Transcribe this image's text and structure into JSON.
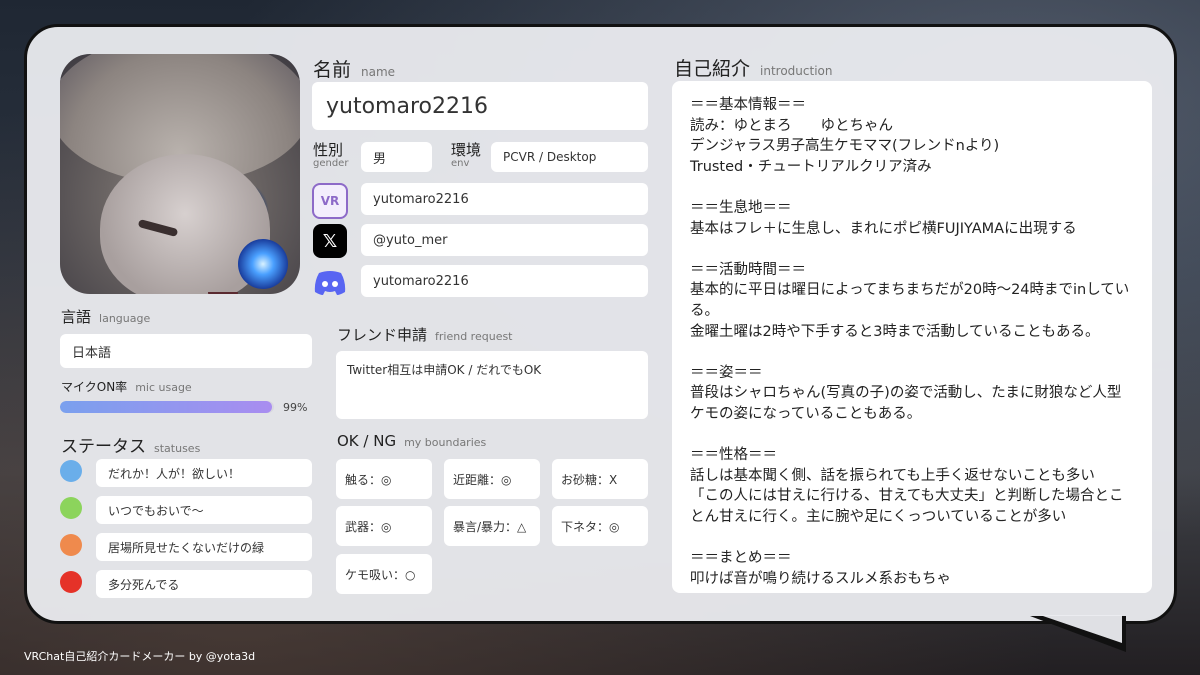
{
  "name": {
    "label_jp": "名前",
    "label_en": "name",
    "value": "yutomaro2216"
  },
  "gender": {
    "label_jp": "性別",
    "label_en": "gender",
    "value": "男"
  },
  "env": {
    "label_jp": "環境",
    "label_en": "env",
    "value": "PCVR / Desktop"
  },
  "sns": [
    {
      "icon": "vrchat-icon",
      "icon_text": "VR",
      "value": "yutomaro2216"
    },
    {
      "icon": "x-icon",
      "icon_text": "𝕏",
      "value": "@yuto_mer"
    },
    {
      "icon": "discord-icon",
      "icon_text": "",
      "value": "yutomaro2216"
    }
  ],
  "language": {
    "label_jp": "言語",
    "label_en": "language",
    "value": "日本語"
  },
  "mic": {
    "label_jp": "マイクON率",
    "label_en": "mic usage",
    "value": "99%",
    "percent": 99
  },
  "statuses": {
    "label_jp": "ステータス",
    "label_en": "statuses",
    "items": [
      {
        "color": "#6aaeea",
        "text": "だれか！人が！欲しい！"
      },
      {
        "color": "#8cd45c",
        "text": "いつでもおいで〜"
      },
      {
        "color": "#ef8a4d",
        "text": "居場所見せたくないだけの緑"
      },
      {
        "color": "#e53228",
        "text": "多分死んでる"
      }
    ]
  },
  "friend_request": {
    "label_jp": "フレンド申請",
    "label_en": "friend request",
    "value": "Twitter相互は申請OK / だれでもOK"
  },
  "boundaries": {
    "label_jp": "OK / NG",
    "label_en": "my boundaries",
    "items": [
      "触る：◎",
      "近距離：◎",
      "お砂糖：X",
      "武器：◎",
      "暴言/暴力：△",
      "下ネタ：◎",
      "ケモ吸い：○"
    ]
  },
  "introduction": {
    "label_jp": "自己紹介",
    "label_en": "introduction",
    "text": "＝＝基本情報＝＝\n読み：ゆとまろ　　ゆとちゃん\nデンジャラス男子高生ケモママ(フレンドnより)\nTrusted・チュートリアルクリア済み\n\n＝＝生息地＝＝\n基本はフレ＋に生息し、まれにポピ横FUJIYAMAに出現する\n\n＝＝活動時間＝＝\n基本的に平日は曜日によってまちまちだが20時〜24時までinしている。\n金曜土曜は2時や下手すると3時まで活動していることもある。\n\n＝＝姿＝＝\n普段はシャロちゃん(写真の子)の姿で活動し、たまに財狼など人型ケモの姿になっていることもある。\n\n＝＝性格＝＝\n話しは基本聞く側、話を振られても上手く返せないことも多い\n「この人には甘えに行ける、甘えても大丈夫」と判断した場合とことん甘えに行く。主に腕や足にくっついていることが多い\n\n＝＝まとめ＝＝\n叩けば音が鳴り続けるスルメ系おもちゃ"
  },
  "footer": "VRChat自己紹介カードメーカー by @yota3d",
  "colors": {
    "card_bg": "#ebecf0",
    "discord": "#5865f2",
    "vrchat": "#8d6ac8",
    "mic_bar": "#8f98ee"
  }
}
